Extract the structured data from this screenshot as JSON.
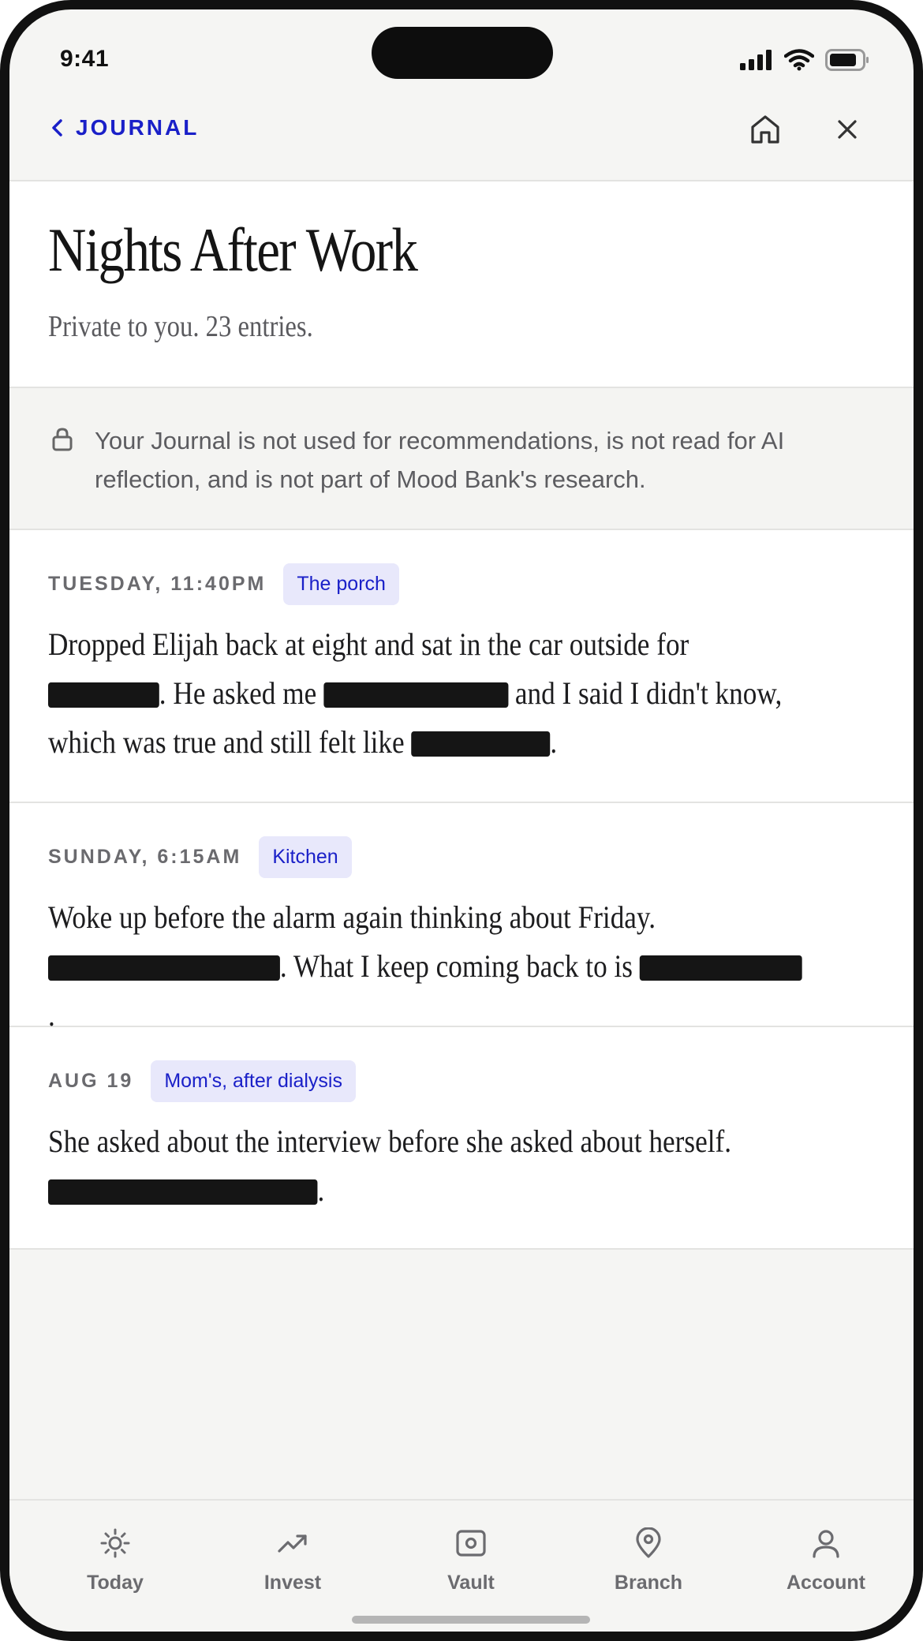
{
  "status_bar": {
    "time": "9:41"
  },
  "nav": {
    "back_label": "JOURNAL",
    "icons": [
      "chevron-left-icon",
      "home-icon",
      "close-icon"
    ]
  },
  "header": {
    "title": "Nights After Work",
    "subtitle": "Private to you. 23 entries."
  },
  "notice": {
    "icon": "lock-icon",
    "text": "Your Journal is not used for recommendations, is not read for AI reflection, and is not part of Mood Bank's research."
  },
  "entries": [
    {
      "date": "TUESDAY, 11:40PM",
      "tag": "The porch",
      "segments": [
        "Dropped Elijah back at eight and sat in the car outside for",
        ". He asked me",
        "and I said I didn't know, which was true and still felt like",
        "."
      ]
    },
    {
      "date": "SUNDAY, 6:15AM",
      "tag": "Kitchen",
      "segments": [
        "Woke up before the alarm again thinking about Friday.",
        ". What I keep coming back to is",
        "."
      ]
    },
    {
      "date": "AUG 19",
      "tag": "Mom's, after dialysis",
      "segments": [
        "She asked about the interview before she asked about herself.",
        "."
      ]
    }
  ],
  "tabbar": {
    "tabs": [
      {
        "label": "Today",
        "icon": "sun-icon"
      },
      {
        "label": "Invest",
        "icon": "trending-up-icon"
      },
      {
        "label": "Vault",
        "icon": "vault-icon"
      },
      {
        "label": "Branch",
        "icon": "map-pin-icon"
      },
      {
        "label": "Account",
        "icon": "user-icon"
      }
    ]
  },
  "colors": {
    "accent": "#1a20c8",
    "tag_background": "#e8e8fb",
    "redaction": "#151515",
    "background": "#f5f5f3"
  }
}
